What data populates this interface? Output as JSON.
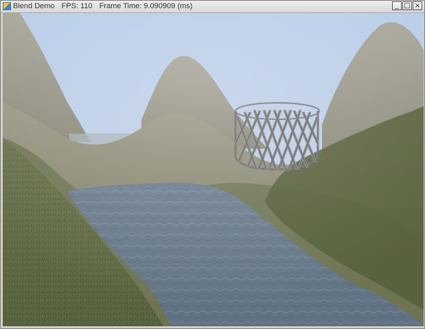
{
  "window": {
    "title": "Blend Demo",
    "fps_label": "FPS: 110",
    "frame_time_label": "Frame Time: 9.090909 (ms)",
    "buttons": {
      "minimize": "_",
      "maximize": "□",
      "close": "×"
    }
  },
  "scene": {
    "colors": {
      "sky": "#bfd0e8",
      "far_hill": "#8b8a7a",
      "mid_hill": "#7d7e62",
      "near_ground": "#5e6a43",
      "water": "#5d6d7f",
      "fog": "#d8dde0",
      "wire_cage": "#808080"
    },
    "icons": {
      "app": "blend-app-icon",
      "minimize": "minimize-icon",
      "maximize": "maximize-icon",
      "close": "close-icon"
    }
  }
}
